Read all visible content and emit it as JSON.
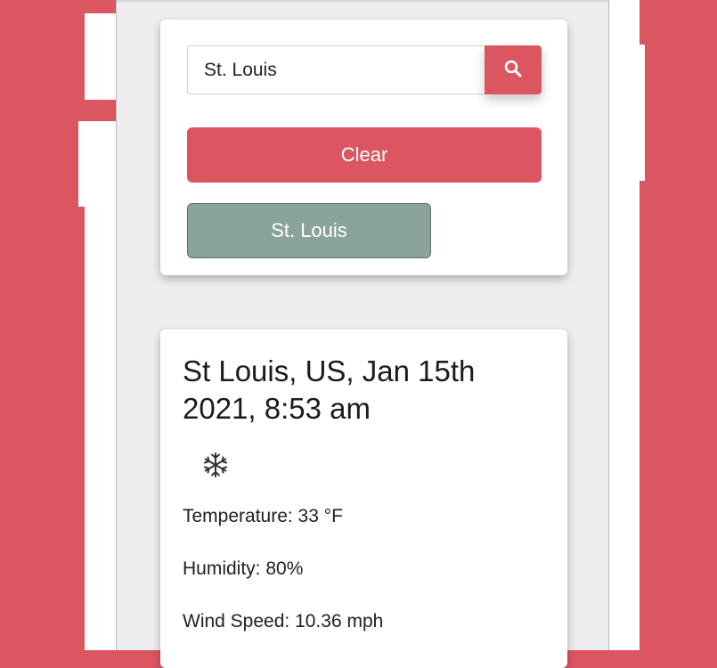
{
  "search": {
    "value": "St. Louis",
    "button_icon": "search-icon"
  },
  "clear_label": "Clear",
  "history": [
    "St. Louis"
  ],
  "weather": {
    "title": "St Louis, US, Jan 15th 2021, 8:53 am",
    "icon": "snowflake-icon",
    "temperature": "Temperature: 33 °F",
    "humidity": "Humidity: 80%",
    "wind": "Wind Speed: 10.36 mph"
  },
  "colors": {
    "accent": "#dc5662",
    "history_button": "#8aa39b",
    "panel_background": "#efedf0",
    "card": "#ffffff"
  }
}
